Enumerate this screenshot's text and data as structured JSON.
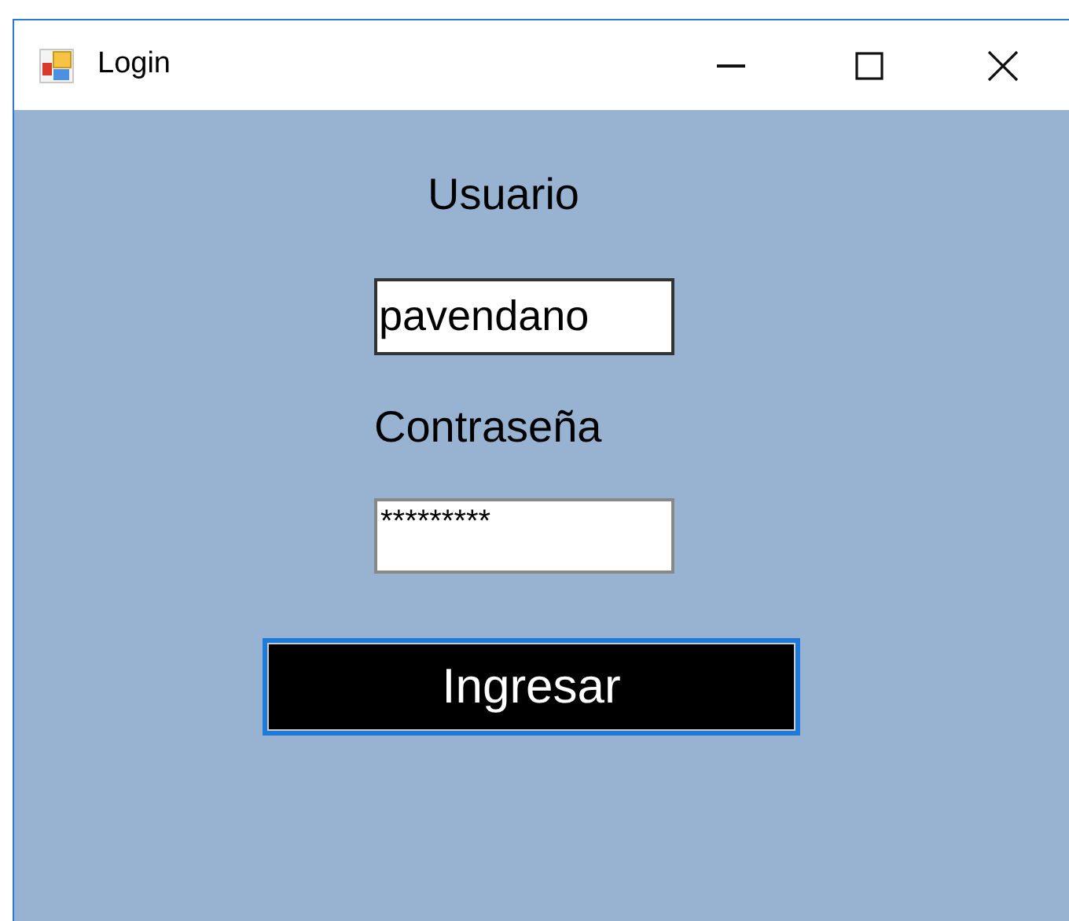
{
  "window": {
    "title": "Login"
  },
  "username_label": "Usuario",
  "username_field": {
    "value": "pavendano"
  },
  "password_label": "Contraseña",
  "password_field": {
    "value": "*********"
  },
  "submit_button": {
    "label": "Ingresar",
    "focused": true
  }
}
